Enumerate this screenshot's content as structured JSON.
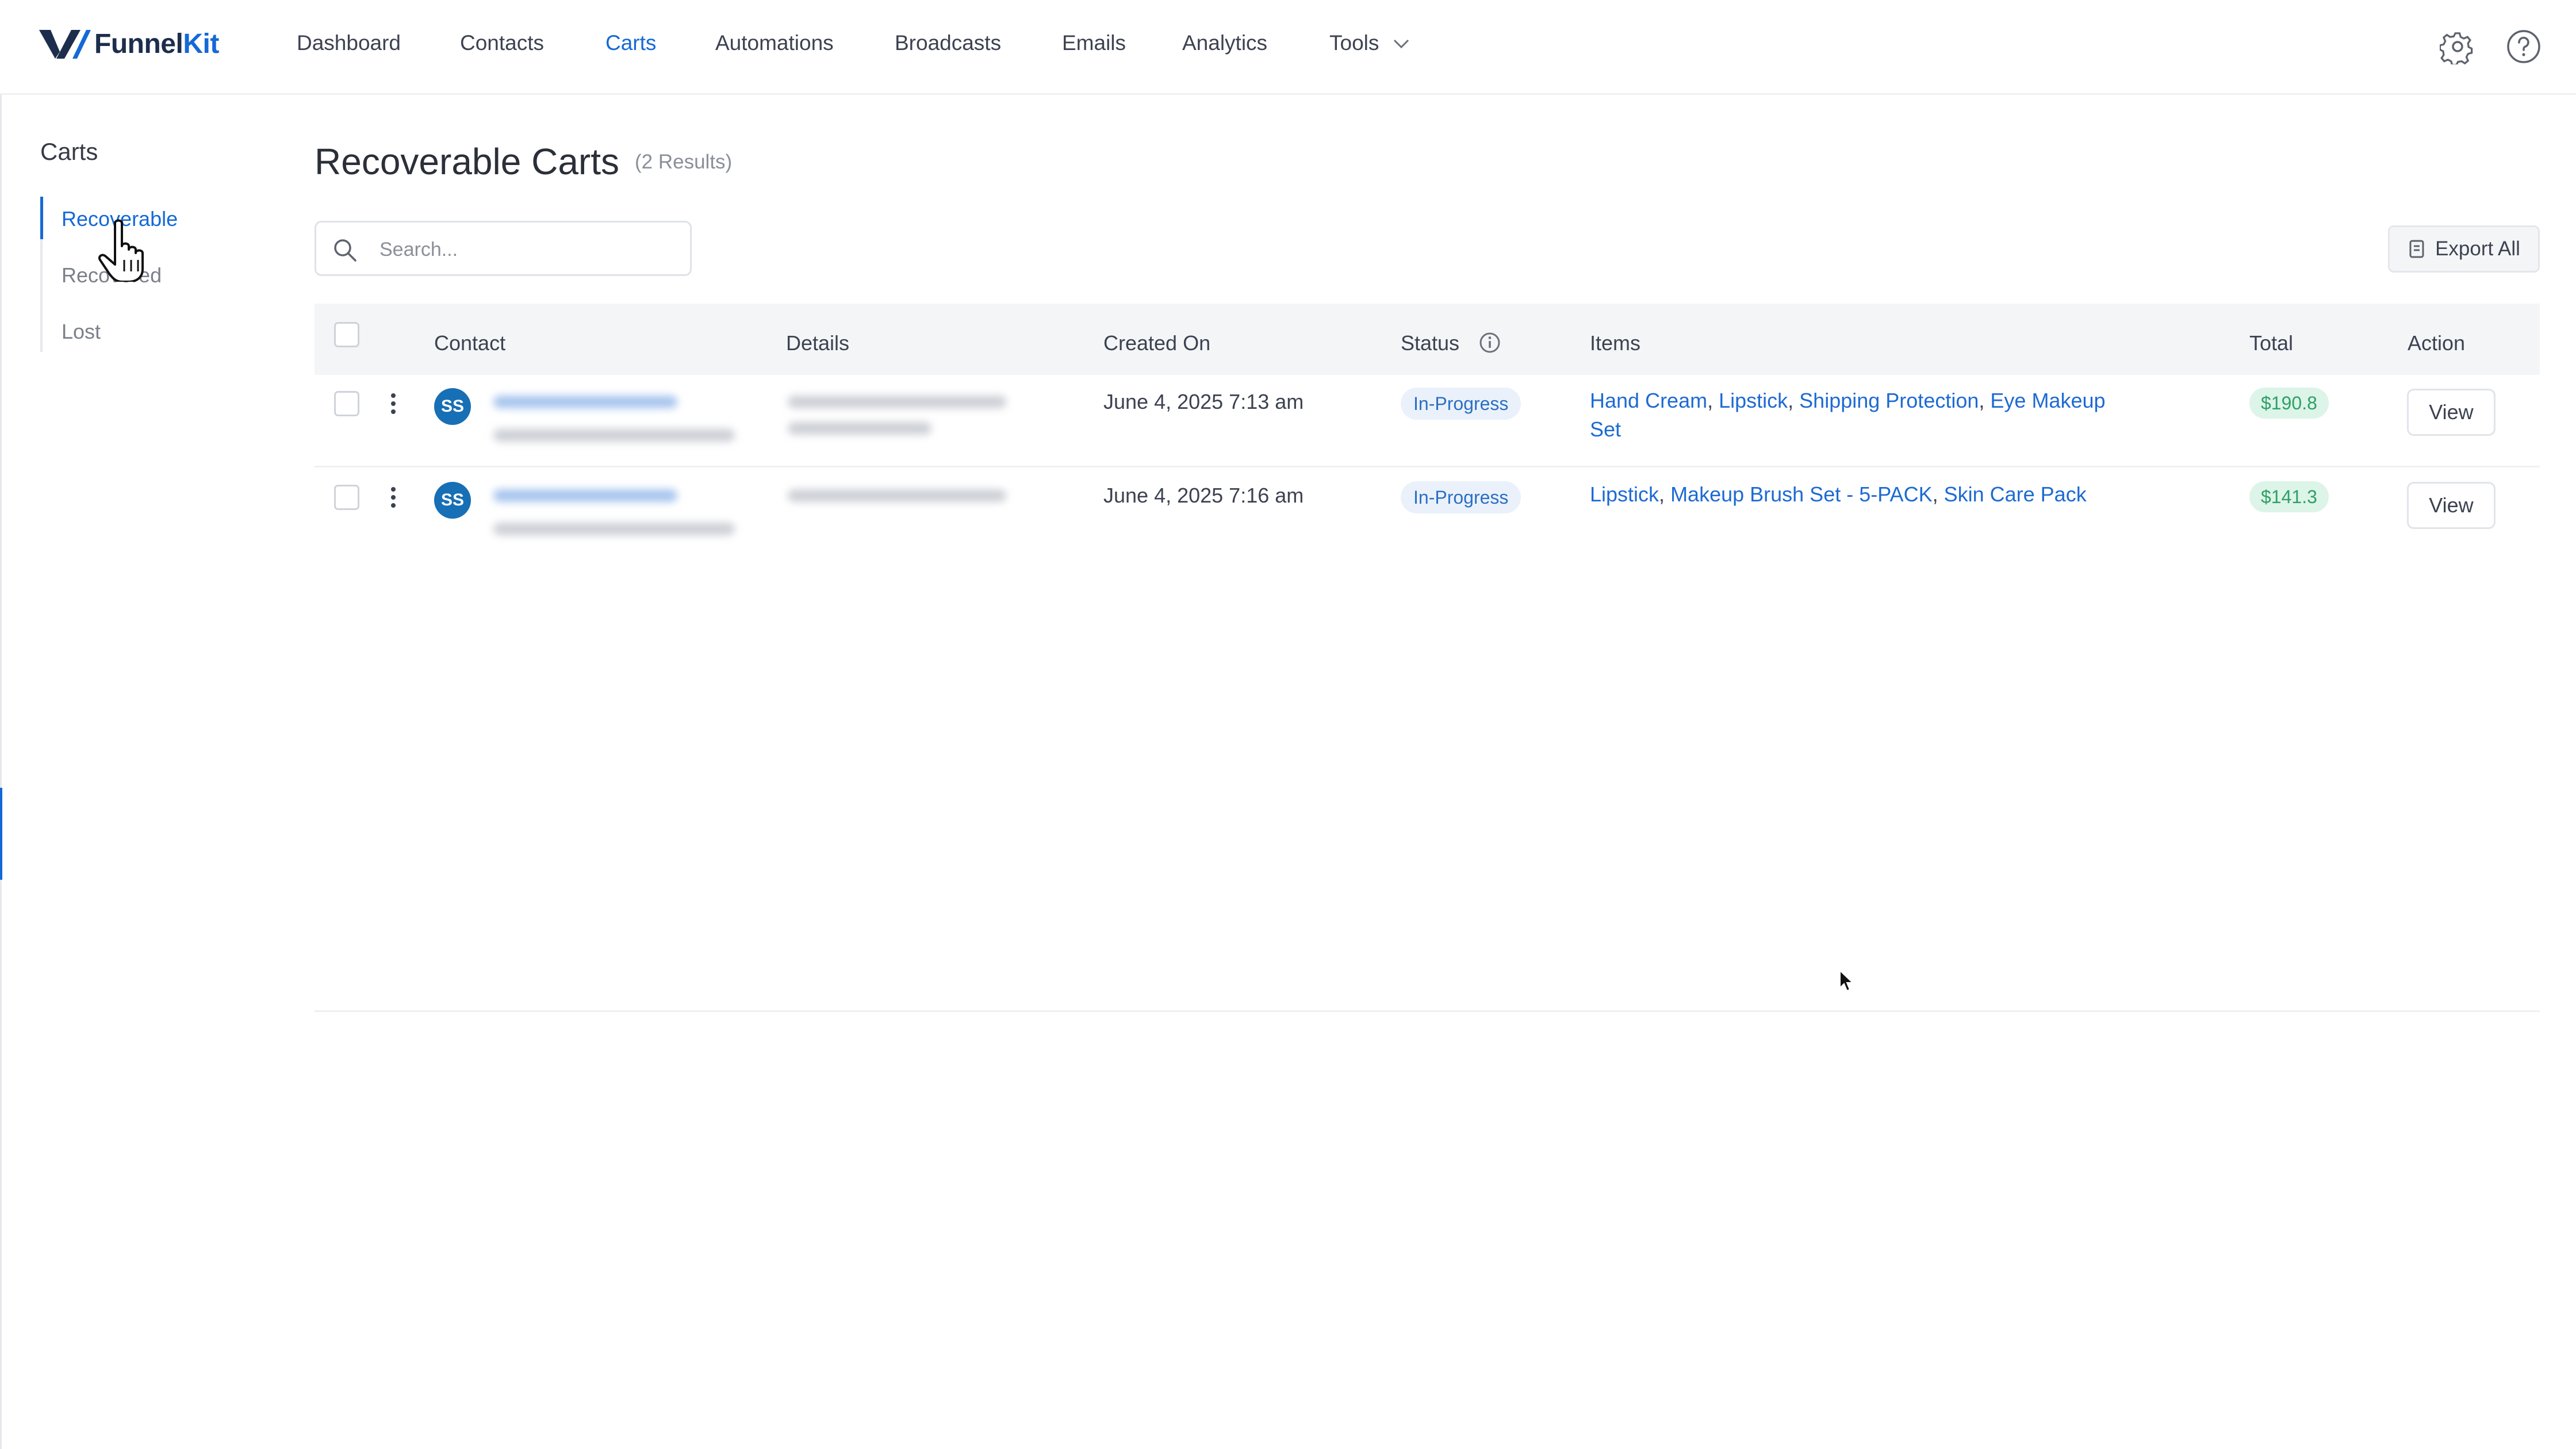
{
  "brand": {
    "name_prefix": "Funnel",
    "name_suffix": "Kit",
    "accent": "#1469d6"
  },
  "nav": {
    "items": [
      {
        "label": "Dashboard",
        "active": false
      },
      {
        "label": "Contacts",
        "active": false
      },
      {
        "label": "Carts",
        "active": true
      },
      {
        "label": "Automations",
        "active": false
      },
      {
        "label": "Broadcasts",
        "active": false
      },
      {
        "label": "Emails",
        "active": false
      },
      {
        "label": "Analytics",
        "active": false
      },
      {
        "label": "Tools",
        "active": false
      }
    ],
    "icons": [
      "gear-icon",
      "help-icon"
    ]
  },
  "sidebar": {
    "title": "Carts",
    "items": [
      {
        "label": "Recoverable",
        "active": true
      },
      {
        "label": "Recovered",
        "active": false
      },
      {
        "label": "Lost",
        "active": false
      }
    ]
  },
  "main": {
    "title": "Recoverable Carts",
    "count": "(2 Results)",
    "search_placeholder": "Search...",
    "export_label": "Export All"
  },
  "table": {
    "columns": [
      "Contact",
      "Details",
      "Created On",
      "Status",
      "Items",
      "Total",
      "Action"
    ],
    "rows": [
      {
        "avatar": "SS",
        "created_on": "June 4, 2025 7:13 am",
        "status": "In-Progress",
        "items": [
          "Hand Cream",
          "Lipstick",
          "Shipping Protection",
          "Eye Makeup Set"
        ],
        "total": "$190.8",
        "action": "View"
      },
      {
        "avatar": "SS",
        "created_on": "June 4, 2025 7:16 am",
        "status": "In-Progress",
        "items": [
          "Lipstick",
          "Makeup Brush Set - 5-PACK",
          "Skin Care Pack"
        ],
        "total": "$141.3",
        "action": "View"
      }
    ]
  },
  "colors": {
    "status_pill_bg": "#eaf1fa",
    "status_pill_text": "#2c6fc3",
    "total_pill_bg": "#ddf4e8",
    "total_pill_text": "#2fa067",
    "avatar_bg": "#176fb5"
  }
}
